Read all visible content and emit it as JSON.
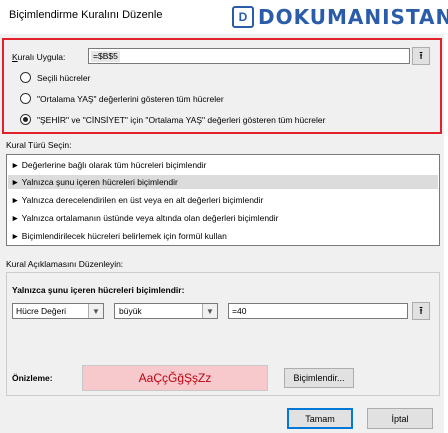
{
  "window": {
    "title": "Biçimlendirme Kuralını Düzenle",
    "watermark": "DOKUMANISTAN",
    "watermark_icon": "D"
  },
  "apply_to": {
    "label_prefix": "K",
    "label_rest": "uralı Uygula:",
    "value": "=$B$5",
    "collapse_icon": "⭱"
  },
  "scope_options": [
    {
      "label": "Seçili hücreler",
      "selected": false
    },
    {
      "label": "\"Ortalama YAŞ\" değerlerini gösteren tüm hücreler",
      "selected": false
    },
    {
      "label": "\"ŞEHİR\" ve \"CİNSİYET\" için \"Ortalama YAŞ\" değerleri gösteren tüm hücreler",
      "selected": true
    }
  ],
  "rule_type": {
    "label": "Kural Türü Seçin:",
    "items": [
      "► Değerlerine bağlı olarak tüm hücreleri biçimlendir",
      "► Yalnızca şunu içeren hücreleri biçimlendir",
      "► Yalnızca derecelendirilen en üst veya en alt değerleri biçimlendir",
      "► Yalnızca ortalamanın üstünde veya altında olan değerleri biçimlendir",
      "► Biçimlendirilecek hücreleri belirlemek için formül kullan"
    ],
    "selected_index": 1
  },
  "rule_desc": {
    "label": "Kural Açıklamasını Düzenleyin:",
    "heading": "Yalnızca şunu içeren hücreleri biçimlendir:",
    "condition_type": "Hücre Değeri",
    "operator": "büyük",
    "value": "=40",
    "preview_label": "Önizleme:",
    "preview_sample": "AaÇçĞğŞşZz",
    "format_button": "Biçimlendir..."
  },
  "buttons": {
    "ok": "Tamam",
    "cancel": "İptal"
  },
  "colors": {
    "highlight_frame": "#e0202a",
    "preview_bg": "#f7c9cc",
    "preview_text": "#c00010",
    "default_button_border": "#0078d7"
  }
}
